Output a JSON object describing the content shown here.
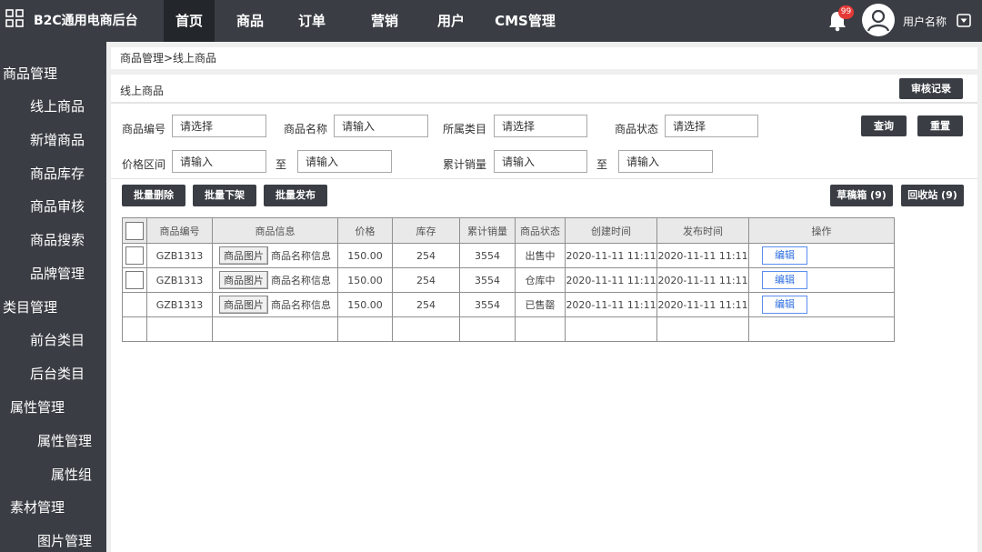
{
  "header": {
    "app_title": "B2C通用电商后台",
    "nav": [
      {
        "label": "首页"
      },
      {
        "label": "商品"
      },
      {
        "label": "订单"
      },
      {
        "label": "营销"
      },
      {
        "label": "用户"
      },
      {
        "label": "CMS管理"
      }
    ],
    "notification_count": "99",
    "username": "用户名称",
    "icons": {
      "logo": "grid-icon",
      "bell": "bell-icon",
      "avatar": "user-avatar-icon",
      "dropdown": "caret-down-icon"
    }
  },
  "sidebar": {
    "items": [
      {
        "label": "商品管理"
      },
      {
        "label": "线上商品"
      },
      {
        "label": "新增商品"
      },
      {
        "label": "商品库存"
      },
      {
        "label": "商品审核"
      },
      {
        "label": "商品搜索"
      },
      {
        "label": "品牌管理"
      },
      {
        "label": "类目管理"
      },
      {
        "label": "前台类目"
      },
      {
        "label": "后台类目"
      },
      {
        "label": "属性管理"
      },
      {
        "label": "属性管理"
      },
      {
        "label": "属性组"
      },
      {
        "label": "素材管理"
      },
      {
        "label": "图片管理"
      }
    ]
  },
  "breadcrumb": "商品管理>线上商品",
  "section": {
    "title": "线上商品",
    "audit_button": "审核记录"
  },
  "filters": {
    "product_code": {
      "label": "商品编号",
      "placeholder": "请选择"
    },
    "product_name": {
      "label": "商品名称",
      "placeholder": "请输入"
    },
    "category": {
      "label": "所属类目",
      "placeholder": "请选择"
    },
    "status": {
      "label": "商品状态",
      "placeholder": "请选择"
    },
    "price_range": {
      "label": "价格区间",
      "from_placeholder": "请输入",
      "to_placeholder": "请输入"
    },
    "sales_range": {
      "label": "累计销量",
      "from_placeholder": "请输入",
      "to_placeholder": "请输入"
    },
    "to_label": "至",
    "query_button": "查询",
    "reset_button": "重置"
  },
  "actions": {
    "batch_delete": "批量删除",
    "batch_offline": "批量下架",
    "batch_publish": "批量发布",
    "drafts": "草稿箱 (9)",
    "recycle_bin": "回收站 (9)"
  },
  "table": {
    "columns": [
      "商品编号",
      "商品信息",
      "价格",
      "库存",
      "累计销量",
      "商品状态",
      "创建时间",
      "发布时间",
      "操作"
    ],
    "rows": [
      {
        "code": "GZB1313",
        "image_btn": "商品图片",
        "name": "商品名称信息",
        "price": "150.00",
        "stock": "254",
        "sales": "3554",
        "status": "出售中",
        "created": "2020-11-11 11:11",
        "published": "2020-11-11 11:11",
        "action": "编辑"
      },
      {
        "code": "GZB1313",
        "image_btn": "商品图片",
        "name": "商品名称信息",
        "price": "150.00",
        "stock": "254",
        "sales": "3554",
        "status": "仓库中",
        "created": "2020-11-11 11:11",
        "published": "2020-11-11 11:11",
        "action": "编辑"
      },
      {
        "code": "GZB1313",
        "image_btn": "商品图片",
        "name": "商品名称信息",
        "price": "150.00",
        "stock": "254",
        "sales": "3554",
        "status": "已售罄",
        "created": "2020-11-11 11:11",
        "published": "2020-11-11 11:11",
        "action": "编辑"
      }
    ]
  }
}
